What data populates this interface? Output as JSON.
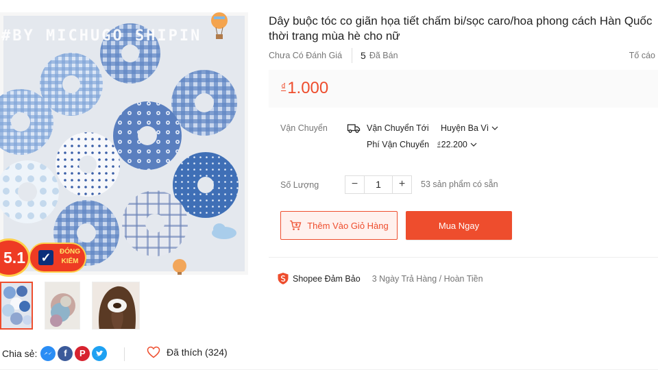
{
  "gallery": {
    "watermark": "#BY MICHUGO SHIPIN",
    "promo": {
      "number": "5.1",
      "badge_line1": "ĐÓNG",
      "badge_line2": "KIỂM"
    },
    "thumbnails": [
      "scrunchie-collection",
      "scrunchie-closeup",
      "scrunchie-worn"
    ]
  },
  "share": {
    "label": "Chia sẻ:",
    "networks": [
      "messenger-icon",
      "facebook-icon",
      "pinterest-icon",
      "twitter-icon"
    ]
  },
  "like": {
    "label": "Đã thích (324)"
  },
  "product": {
    "title_line1": "Dây buộc tóc co giãn họa tiết chấm bi/sọc caro/hoa phong cách Hàn Quốc",
    "title_line2": "thời trang mùa hè cho nữ",
    "rating_text": "Chưa Có Đánh Giá",
    "sold_count": "5",
    "sold_label": "Đã Bán",
    "report_label": "Tố cáo",
    "price_currency": "₫",
    "price": "1.000"
  },
  "shipping": {
    "label": "Vận Chuyển",
    "to_label": "Vận Chuyển Tới",
    "to_value": "Huyện Ba Vì",
    "fee_label": "Phí Vận Chuyển",
    "fee_currency": "₫",
    "fee_value": "22.200"
  },
  "quantity": {
    "label": "Số Lượng",
    "minus": "−",
    "value": "1",
    "plus": "+",
    "stock_text": "53 sản phẩm có sẵn"
  },
  "actions": {
    "add_to_cart": "Thêm Vào Giỏ Hàng",
    "buy_now": "Mua Ngay"
  },
  "guarantee": {
    "title": "Shopee Đảm Bảo",
    "desc": "3 Ngày Trả Hàng / Hoàn Tiền"
  },
  "colors": {
    "accent": "#ee4d2d",
    "price_bg": "#fafafa",
    "add_cart_bg": "#fff1ee"
  }
}
